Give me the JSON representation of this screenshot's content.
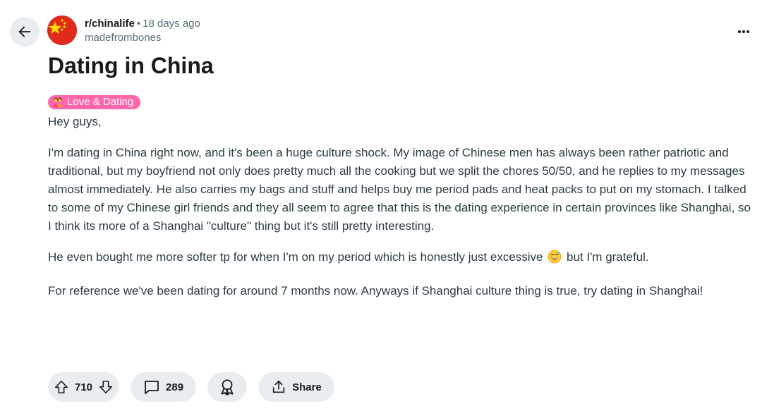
{
  "header": {
    "subreddit": "r/chinalife",
    "separator": "•",
    "time_ago": "18 days ago",
    "author": "madefrombones"
  },
  "post": {
    "title": "Dating in China",
    "flair": {
      "label": "Love & Dating",
      "color": "#ff66ac"
    },
    "paragraphs": [
      "Hey guys,",
      "I'm dating in China right now, and it's been a huge culture shock. My image of Chinese men has always been rather patriotic and traditional, but my boyfriend not only does pretty much all the cooking but we split the chores 50/50, and he replies to my messages almost immediately. He also carries my bags and stuff and helps buy me period pads and heat packs to put on my stomach. I talked to some of my Chinese girl friends and they all seem to agree that this is the dating experience in certain provinces like Shanghai, so I think its more of a Shanghai \"culture\" thing but it's still pretty interesting.",
      "He even bought me more softer tp for when I'm on my period which is honestly just excessive",
      "but I'm grateful.",
      "For reference we've been dating for around 7 months now. Anyways if Shanghai culture thing is true, try dating in Shanghai!"
    ]
  },
  "actions": {
    "upvote_count": "710",
    "comment_count": "289",
    "share_label": "Share"
  },
  "icons": {
    "back": "arrow-left-icon",
    "avatar": "china-flag-icon",
    "more": "more-dots-icon",
    "flair": "couple-emoji-icon",
    "emoji": "sweat-smile-emoji-icon",
    "upvote": "upvote-arrow-icon",
    "downvote": "downvote-arrow-icon",
    "comment": "comment-bubble-icon",
    "award": "award-icon",
    "share": "share-icon"
  },
  "colors": {
    "pill_background": "#e9edf0",
    "avatar_red": "#e02a1b",
    "star_yellow": "#ffde00",
    "meta_gray": "#576f76",
    "body_text": "#2a3c42"
  }
}
